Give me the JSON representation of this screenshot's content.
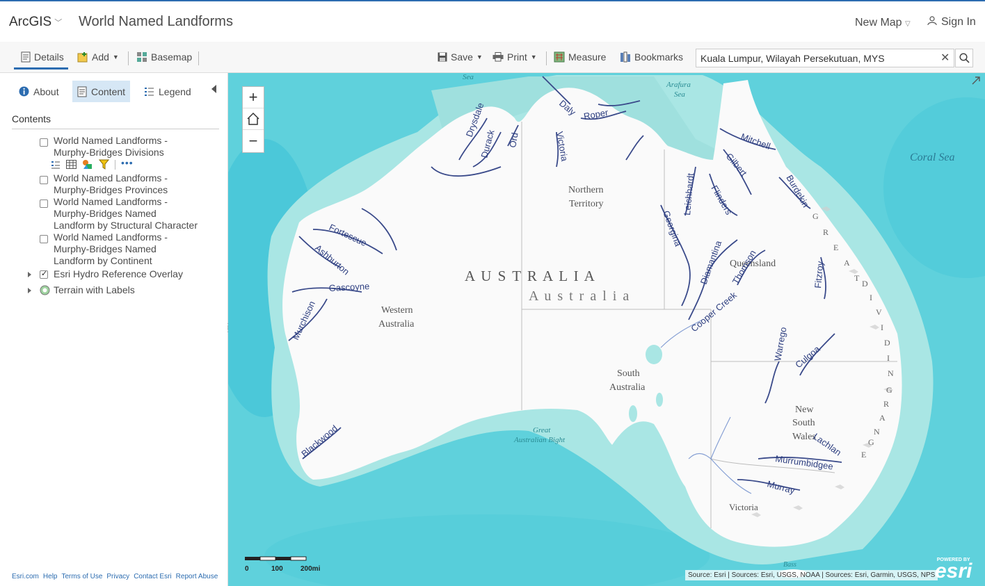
{
  "header": {
    "brand": "ArcGIS",
    "map_title": "World Named Landforms",
    "new_map": "New Map",
    "sign_in": "Sign In"
  },
  "toolbar": {
    "details": "Details",
    "add": "Add",
    "basemap": "Basemap",
    "save": "Save",
    "print": "Print",
    "measure": "Measure",
    "bookmarks": "Bookmarks",
    "search_value": "Kuala Lumpur, Wilayah Persekutuan, MYS"
  },
  "sidebar": {
    "tabs": {
      "about": "About",
      "content": "Content",
      "legend": "Legend"
    },
    "contents_label": "Contents",
    "layers": [
      {
        "lines": [
          "World Named Landforms -",
          "Murphy-Bridges Divisions"
        ],
        "checked": false
      },
      {
        "lines": [
          "World Named Landforms -",
          "Murphy-Bridges Provinces"
        ],
        "checked": false
      },
      {
        "lines": [
          "World Named Landforms -",
          "Murphy-Bridges Named",
          "Landform by Structural Character"
        ],
        "checked": false
      },
      {
        "lines": [
          "World Named Landforms -",
          "Murphy-Bridges Named",
          "Landform by Continent"
        ],
        "checked": false
      },
      {
        "lines": [
          "Esri Hydro Reference Overlay"
        ],
        "checked": true
      },
      {
        "lines": [
          "Terrain with Labels"
        ],
        "checked": false
      }
    ],
    "footer_links": [
      "Esri.com",
      "Help",
      "Terms of Use",
      "Privacy",
      "Contact Esri",
      "Report Abuse"
    ]
  },
  "map": {
    "zoom_in": "+",
    "zoom_out": "−",
    "country_upper": "A U S T R A L I A",
    "country_lower": "A u s t r a l i a",
    "regions": {
      "northern_territory": [
        "Northern",
        "Territory"
      ],
      "western_australia": [
        "Western",
        "Australia"
      ],
      "south_australia": [
        "South",
        "Australia"
      ],
      "queensland": "Queensland",
      "new_south_wales": [
        "New",
        "South",
        "Wales"
      ],
      "victoria": "Victoria"
    },
    "seas": {
      "sea": "Sea",
      "arafura": [
        "Arafura",
        "Sea"
      ],
      "coral": "Coral Sea",
      "bight": [
        "Great",
        "Australian Bight"
      ],
      "bass": "Bass"
    },
    "range_letters": [
      "G",
      "R",
      "E",
      "A",
      "T",
      "D",
      "I",
      "V",
      "I",
      "D",
      "I",
      "N",
      "G",
      "R",
      "A",
      "N",
      "G",
      "E"
    ],
    "rivers": {
      "daly": "Daly",
      "roper": "Roper",
      "drysdale": "Drysdale",
      "durack": "Durack",
      "ord": "Ord",
      "victoria": "Victoria",
      "mitchell": "Mitchell",
      "gilbert": "Gilbert",
      "burdekin": "Burdekin",
      "leichhardt": "Leichhardt",
      "flinders": "Flinders",
      "georgina": "Georgina",
      "diamantina": "Diamantina",
      "thomson": "Thomson",
      "cooper": "Cooper Creek",
      "fitzroy": "Fitzroy",
      "fortescue": "Fortescue",
      "ashburton": "Ashburton",
      "gascoyne": "Gascoyne",
      "murchison": "Murchison",
      "blackwood": "Blackwood",
      "warrego": "Warrego",
      "culgoa": "Culgoa",
      "lachlan": "Lachlan",
      "murrumbidgee": "Murrumbidgee",
      "murray": "Murray"
    },
    "scale_labels": [
      "0",
      "100",
      "200mi"
    ],
    "attribution": "Source: Esri | Sources: Esri, USGS, NOAA | Sources: Esri, Garmin, USGS, NPS",
    "esri_powered": "POWERED BY",
    "esri_logo": "esri"
  }
}
